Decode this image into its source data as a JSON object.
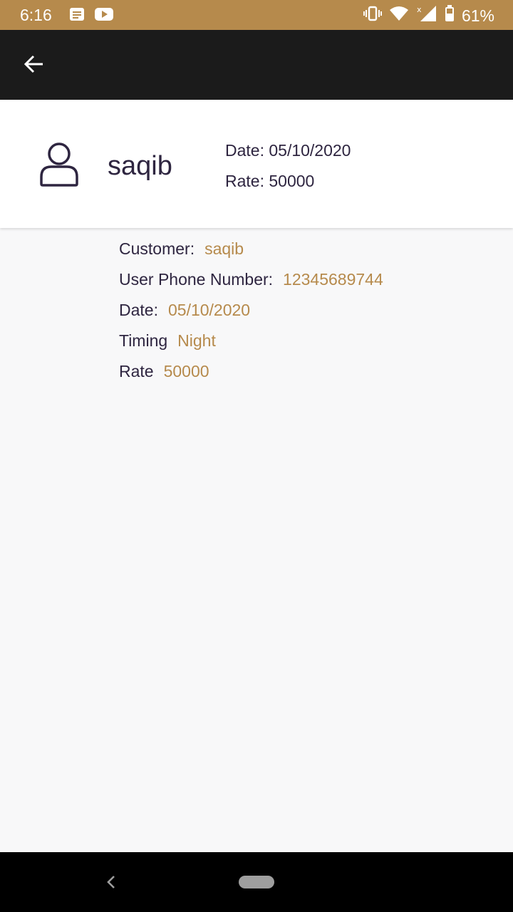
{
  "status_bar": {
    "time": "6:16",
    "battery": "61%",
    "icons": [
      "notes-icon",
      "youtube-icon",
      "vibrate-icon",
      "wifi-icon",
      "signal-icon",
      "battery-icon"
    ]
  },
  "app_bar": {
    "back_icon": "arrow-left-icon"
  },
  "card": {
    "name": "saqib",
    "date": "Date: 05/10/2020",
    "rate": "Rate: 50000"
  },
  "details": [
    {
      "label": "Customer:",
      "value": "saqib"
    },
    {
      "label": "User Phone Number:",
      "value": "12345689744"
    },
    {
      "label": "Date:",
      "value": "05/10/2020"
    },
    {
      "label": "Timing",
      "value": "Night"
    },
    {
      "label": "Rate",
      "value": "50000"
    }
  ],
  "colors": {
    "accent": "#b68a4c",
    "app_bar": "#1b1b1b",
    "text": "#2e2540",
    "background": "#f8f8f9"
  }
}
